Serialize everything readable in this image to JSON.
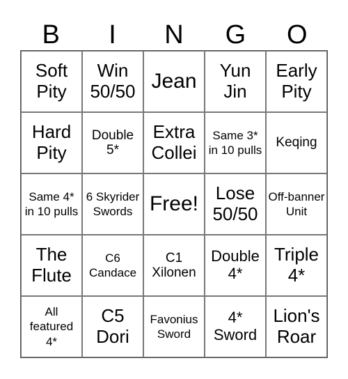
{
  "header": [
    "B",
    "I",
    "N",
    "G",
    "O"
  ],
  "cells": [
    [
      "Soft Pity",
      "Win 50/50",
      "Jean",
      "Yun Jin",
      "Early Pity"
    ],
    [
      "Hard Pity",
      "Double 5*",
      "Extra Collei",
      "Same 3* in 10 pulls",
      "Keqing"
    ],
    [
      "Same 4* in 10 pulls",
      "6 Skyrider Swords",
      "Free!",
      "Lose 50/50",
      "Off-banner Unit"
    ],
    [
      "The Flute",
      "C6 Candace",
      "C1 Xilonen",
      "Double 4*",
      "Triple 4*"
    ],
    [
      "All featured 4*",
      "C5 Dori",
      "Favonius Sword",
      "4* Sword",
      "Lion's Roar"
    ]
  ]
}
